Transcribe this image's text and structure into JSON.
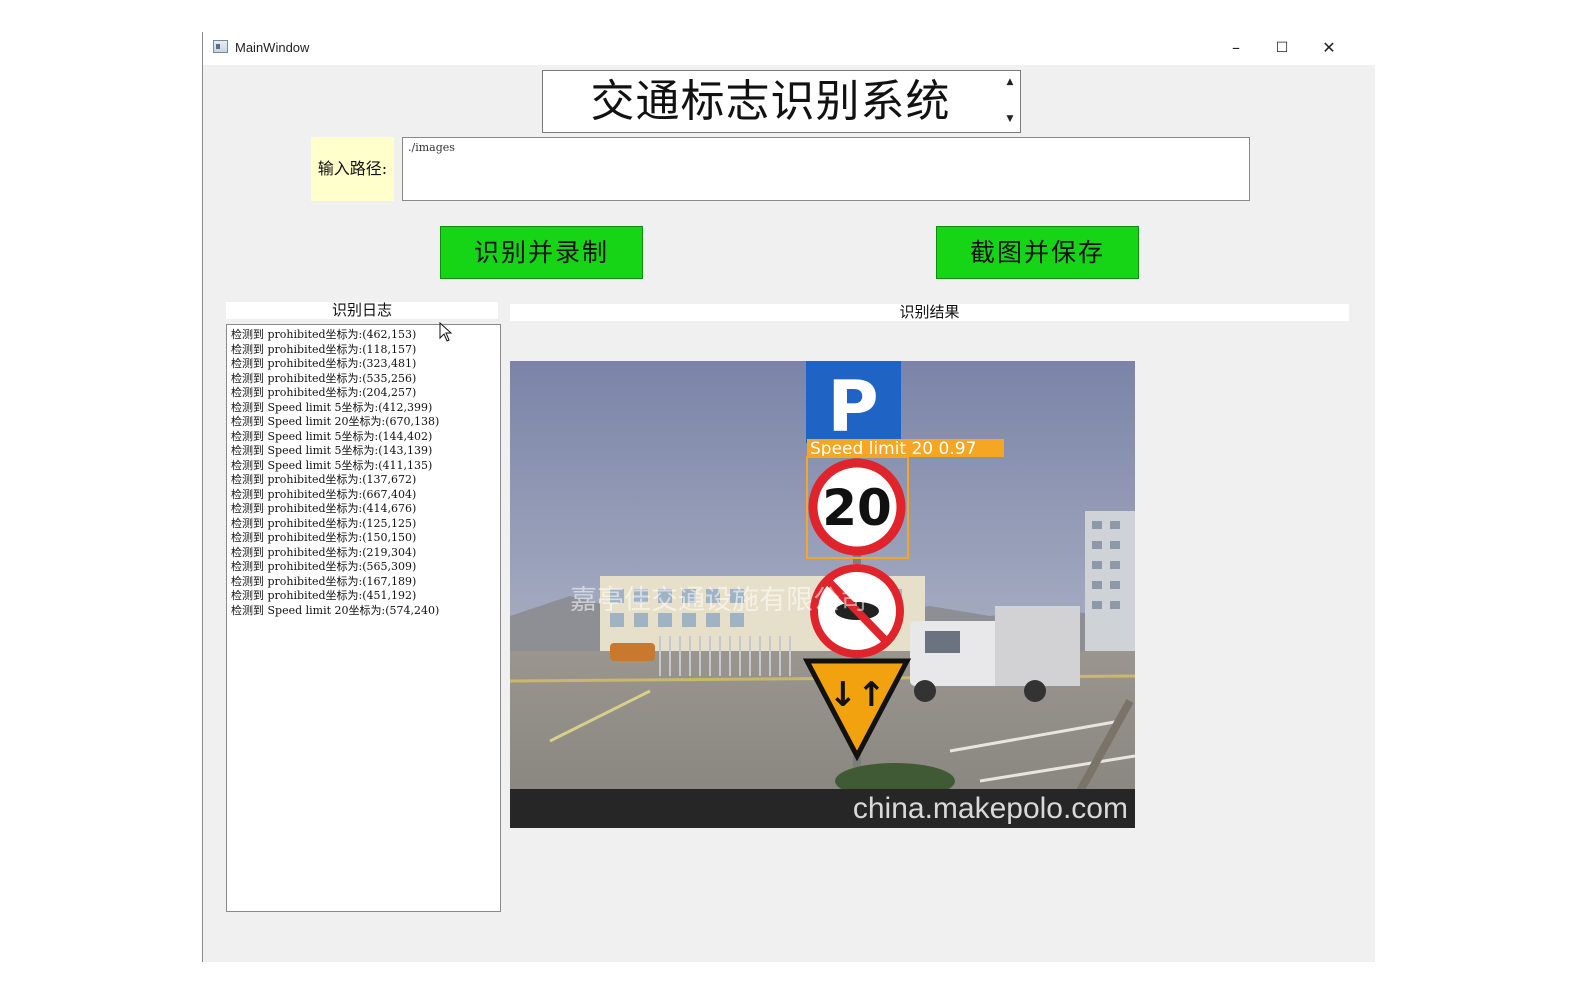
{
  "window": {
    "title": "MainWindow",
    "controls": {
      "minimize": "–",
      "maximize": "☐",
      "close": "✕"
    }
  },
  "header": {
    "title": "交通标志识别系统",
    "spin_up": "▲",
    "spin_down": "▼"
  },
  "path": {
    "label": "输入路径:",
    "value": "./images"
  },
  "buttons": {
    "recognize_record": "识别并录制",
    "screenshot_save": "截图并保存"
  },
  "log": {
    "title": "识别日志",
    "lines": [
      "检测到 prohibited坐标为:(462,153)",
      "检测到 prohibited坐标为:(118,157)",
      "检测到 prohibited坐标为:(323,481)",
      "检测到 prohibited坐标为:(535,256)",
      "检测到 prohibited坐标为:(204,257)",
      "检测到 Speed limit 5坐标为:(412,399)",
      "检测到 Speed limit 20坐标为:(670,138)",
      "检测到 Speed limit 5坐标为:(144,402)",
      "检测到 Speed limit 5坐标为:(143,139)",
      "检测到 Speed limit 5坐标为:(411,135)",
      "检测到 prohibited坐标为:(137,672)",
      "检测到 prohibited坐标为:(667,404)",
      "检测到 prohibited坐标为:(414,676)",
      "检测到 prohibited坐标为:(125,125)",
      "检测到 prohibited坐标为:(150,150)",
      "检测到 prohibited坐标为:(219,304)",
      "检测到 prohibited坐标为:(565,309)",
      "检测到 prohibited坐标为:(167,189)",
      "检测到 prohibited坐标为:(451,192)",
      "检测到 Speed limit 20坐标为:(574,240)"
    ]
  },
  "result": {
    "title": "识别结果",
    "detection_label": "Speed limit 20 0.97",
    "sign_parking": "P",
    "sign_speed": "20",
    "sign_arrows": "↓↑",
    "watermark_company": "嘉亭佳交通设施有限公司",
    "watermark_site": "china.makepolo.com"
  },
  "colors": {
    "button_green": "#16d416",
    "path_label_bg": "#ffffcc",
    "detection_box": "#f5a623",
    "window_bg": "#f0f0f0"
  }
}
